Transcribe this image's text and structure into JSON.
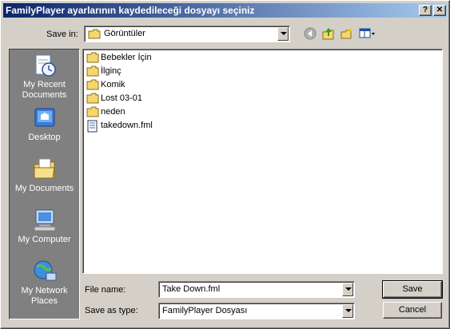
{
  "window": {
    "title": "FamilyPlayer ayarlarının kaydedileceği dosyayı seçiniz",
    "help_label": "?",
    "close_label": "✕"
  },
  "toolbar": {
    "save_in_label": "Save in:",
    "save_in_value": "Görüntüler",
    "back_icon": "back-arrow-icon",
    "up_icon": "up-folder-icon",
    "new_folder_icon": "new-folder-icon",
    "views_icon": "views-menu-icon"
  },
  "places": [
    {
      "label": "My Recent Documents",
      "icon": "recent-documents-icon"
    },
    {
      "label": "Desktop",
      "icon": "desktop-icon"
    },
    {
      "label": "My Documents",
      "icon": "my-documents-icon"
    },
    {
      "label": "My Computer",
      "icon": "my-computer-icon"
    },
    {
      "label": "My Network Places",
      "icon": "network-places-icon"
    }
  ],
  "files": [
    {
      "name": "Bebekler İçin",
      "type": "folder"
    },
    {
      "name": "İlginç",
      "type": "folder"
    },
    {
      "name": "Komik",
      "type": "folder"
    },
    {
      "name": "Lost 03-01",
      "type": "folder"
    },
    {
      "name": "neden",
      "type": "folder"
    },
    {
      "name": "takedown.fml",
      "type": "file"
    }
  ],
  "form": {
    "file_name_label": "File name:",
    "file_name_value": "Take Down.fml",
    "save_as_type_label": "Save as type:",
    "save_as_type_value": "FamilyPlayer Dosyası"
  },
  "buttons": {
    "save_label": "Save",
    "cancel_label": "Cancel"
  },
  "colors": {
    "title_start": "#0a246a",
    "title_end": "#a6caf0",
    "dialog_bg": "#d4d0c8",
    "places_bg": "#808080",
    "folder": "#f5d76e"
  }
}
